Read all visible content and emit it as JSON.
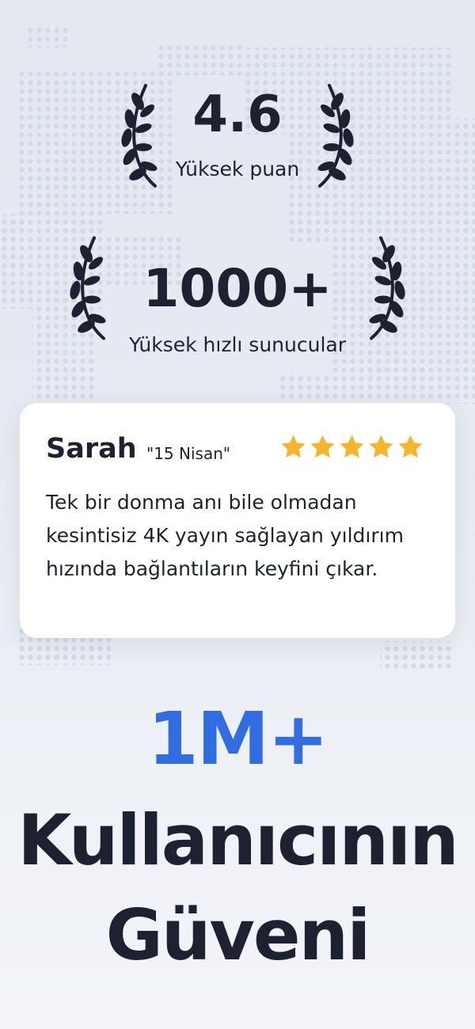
{
  "awards": [
    {
      "value": "4.6",
      "label": "Yüksek puan",
      "icon_left": "laurel-left-icon",
      "icon_right": "laurel-right-icon"
    },
    {
      "value": "1000+",
      "label": "Yüksek hızlı sunucular",
      "icon_left": "laurel-left-icon",
      "icon_right": "laurel-right-icon"
    }
  ],
  "review": {
    "name": "Sarah",
    "date": "\"15 Nisan\"",
    "rating": 5,
    "text": "Tek bir donma anı bile olmadan kesintisiz 4K yayın sağlayan yıldırım hızında bağlantıların keyfini çıkar."
  },
  "headline": {
    "accent": "1M+",
    "line1": "Kullanıcının",
    "line2": "Güveni"
  },
  "colors": {
    "accent": "#2f6de0",
    "text": "#1e2130",
    "star": "#f7b52c",
    "background": "#e5e9f1"
  }
}
